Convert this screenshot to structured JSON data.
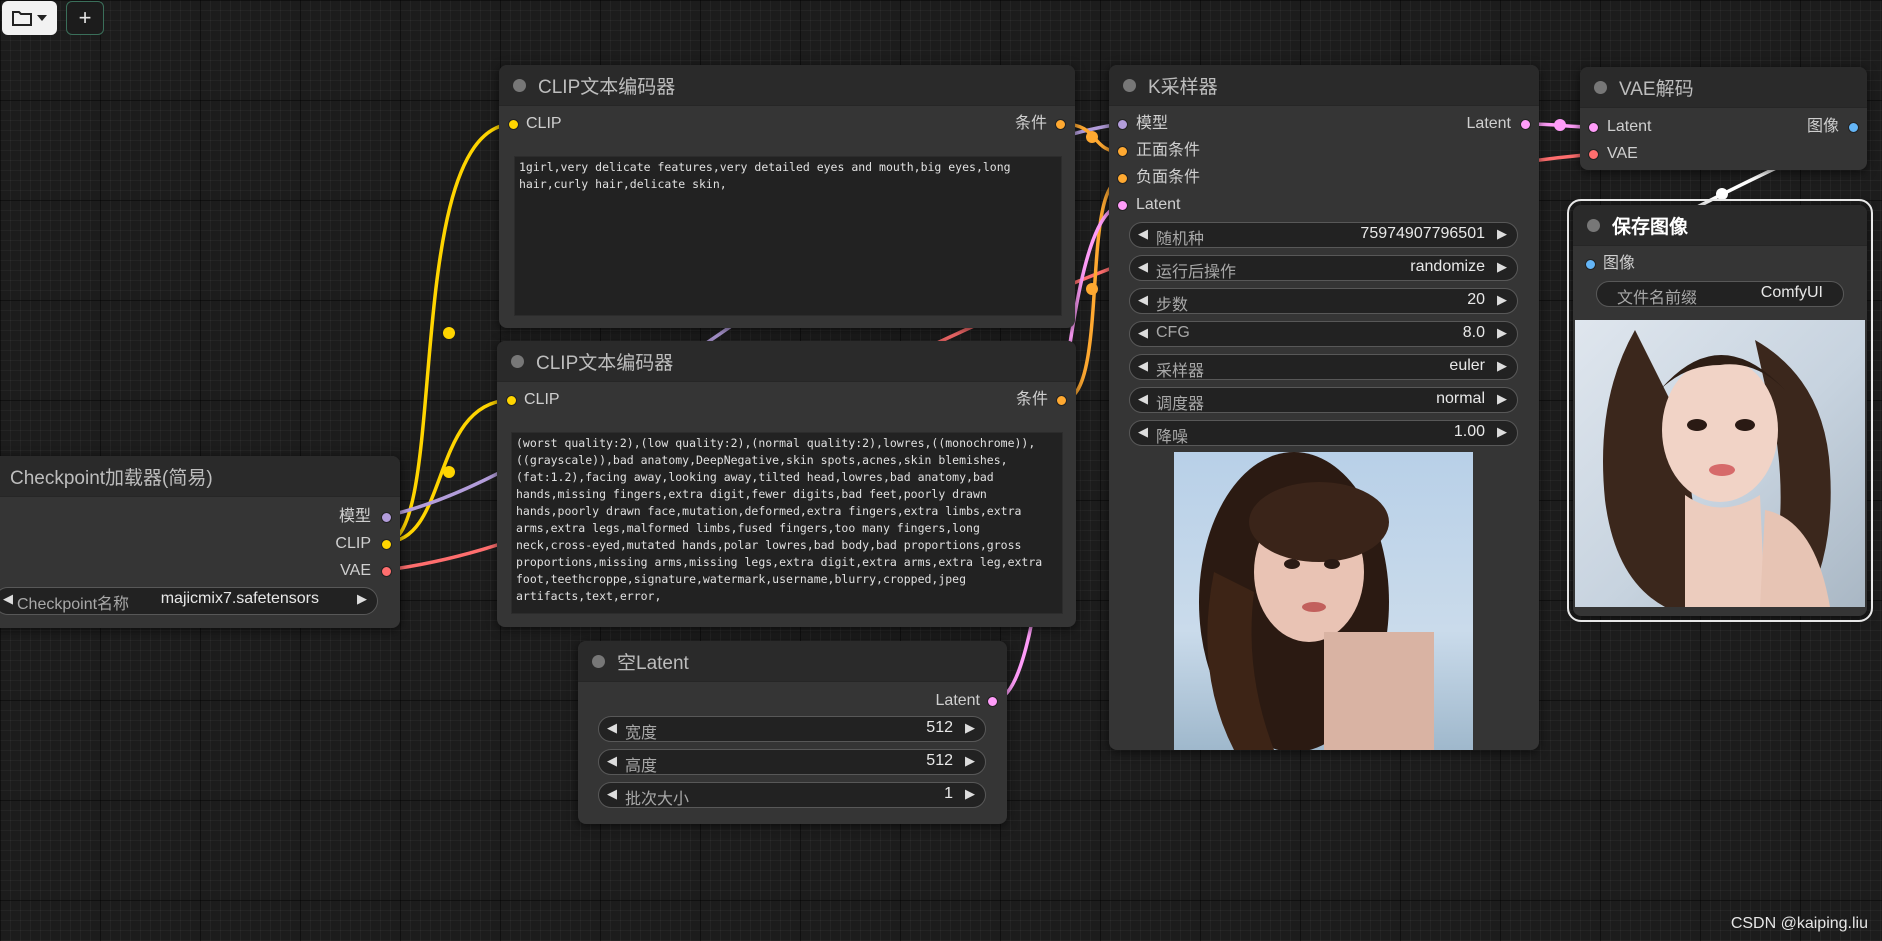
{
  "toolbar": {
    "folder_icon": "folder-icon",
    "dropdown_icon": "caret-down-icon",
    "add_label": "+"
  },
  "nodes": {
    "clip_pos": {
      "title": "CLIP文本编码器",
      "input_clip": "CLIP",
      "output_cond": "条件",
      "text": "1girl,very delicate features,very detailed eyes and mouth,big eyes,long hair,curly hair,delicate skin,"
    },
    "clip_neg": {
      "title": "CLIP文本编码器",
      "input_clip": "CLIP",
      "output_cond": "条件",
      "text": "(worst quality:2),(low quality:2),(normal quality:2),lowres,((monochrome)),((grayscale)),bad anatomy,DeepNegative,skin spots,acnes,skin blemishes,(fat:1.2),facing away,looking away,tilted head,lowres,bad anatomy,bad hands,missing fingers,extra digit,fewer digits,bad feet,poorly drawn hands,poorly drawn face,mutation,deformed,extra fingers,extra limbs,extra arms,extra legs,malformed limbs,fused fingers,too many fingers,long neck,cross-eyed,mutated hands,polar lowres,bad body,bad proportions,gross proportions,missing arms,missing legs,extra digit,extra arms,extra leg,extra foot,teethcroppe,signature,watermark,username,blurry,cropped,jpeg artifacts,text,error,"
    },
    "checkpoint": {
      "title": "Checkpoint加载器(简易)",
      "out_model": "模型",
      "out_clip": "CLIP",
      "out_vae": "VAE",
      "widget_label": "Checkpoint名称",
      "widget_value": "majicmix7.safetensors"
    },
    "empty_latent": {
      "title": "空Latent",
      "out_latent": "Latent",
      "widgets": [
        {
          "label": "宽度",
          "value": "512"
        },
        {
          "label": "高度",
          "value": "512"
        },
        {
          "label": "批次大小",
          "value": "1"
        }
      ]
    },
    "ksampler": {
      "title": "K采样器",
      "in_model": "模型",
      "in_pos": "正面条件",
      "in_neg": "负面条件",
      "in_latent": "Latent",
      "out_latent": "Latent",
      "widgets": [
        {
          "label": "随机种",
          "value": "75974907796501"
        },
        {
          "label": "运行后操作",
          "value": "randomize"
        },
        {
          "label": "步数",
          "value": "20"
        },
        {
          "label": "CFG",
          "value": "8.0"
        },
        {
          "label": "采样器",
          "value": "euler"
        },
        {
          "label": "调度器",
          "value": "normal"
        },
        {
          "label": "降噪",
          "value": "1.00"
        }
      ]
    },
    "vae_decode": {
      "title": "VAE解码",
      "in_latent": "Latent",
      "in_vae": "VAE",
      "out_image": "图像"
    },
    "save_image": {
      "title": "保存图像",
      "in_image": "图像",
      "widget_label": "文件名前缀",
      "widget_value": "ComfyUI"
    }
  },
  "colors": {
    "clip": "#ffd500",
    "conditioning": "#ffa931",
    "model": "#b39ddb",
    "latent": "#ff9cf9",
    "vae": "#ff6e6e",
    "image": "#64b5f6"
  },
  "watermark": "CSDN @kaiping.liu"
}
